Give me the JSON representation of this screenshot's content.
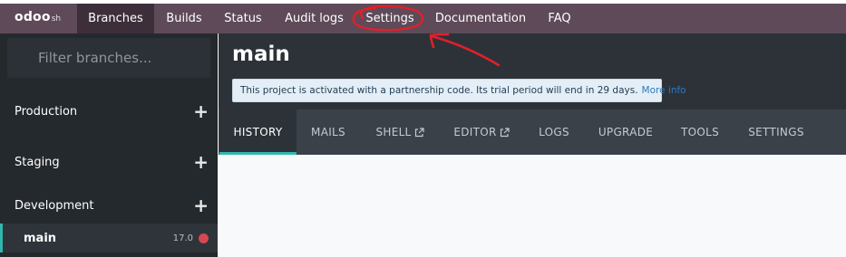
{
  "logo": {
    "main": "odoo",
    "sub": "sh"
  },
  "topnav": {
    "items": [
      {
        "label": "Branches",
        "active": true
      },
      {
        "label": "Builds"
      },
      {
        "label": "Status"
      },
      {
        "label": "Audit logs"
      },
      {
        "label": "Settings"
      },
      {
        "label": "Documentation"
      },
      {
        "label": "FAQ"
      }
    ]
  },
  "sidebar": {
    "filter_placeholder": "Filter branches...",
    "groups": [
      {
        "label": "Production"
      },
      {
        "label": "Staging"
      },
      {
        "label": "Development"
      }
    ],
    "branches": [
      {
        "name": "main",
        "version": "17.0",
        "status_color": "#d6474f"
      }
    ],
    "add_icon": "+"
  },
  "main": {
    "title": "main",
    "notice_text": "This project is activated with a partnership code. Its trial period will end in 29 days.",
    "notice_link": "More info",
    "tabs": [
      {
        "label": "HISTORY",
        "active": true
      },
      {
        "label": "MAILS"
      },
      {
        "label": "SHELL",
        "external": true
      },
      {
        "label": "EDITOR",
        "external": true
      },
      {
        "label": "LOGS"
      },
      {
        "label": "UPGRADE"
      },
      {
        "label": "TOOLS"
      },
      {
        "label": "SETTINGS"
      }
    ]
  },
  "colors": {
    "topbar": "#5e4a59",
    "accent": "#2fb8ad",
    "annotation": "#e0202a"
  },
  "icons": {
    "external_link": "external-link-icon",
    "add": "plus-icon"
  }
}
